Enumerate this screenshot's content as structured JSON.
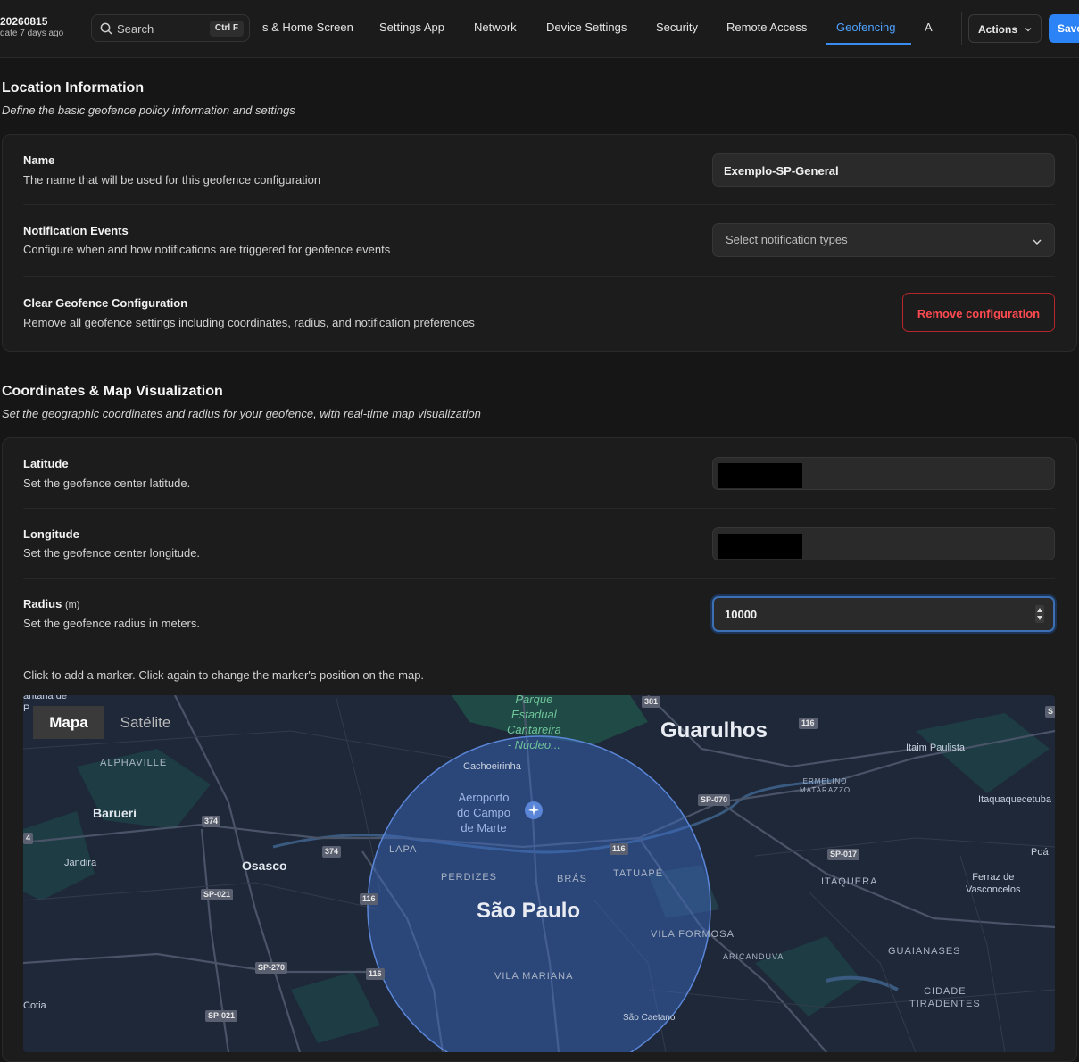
{
  "header": {
    "version_id": "20260815",
    "version_note": "date 7 days ago",
    "search_placeholder": "Search",
    "search_shortcut": "Ctrl F",
    "tabs": [
      {
        "label": "s & Home Screen",
        "active": false
      },
      {
        "label": "Settings App",
        "active": false
      },
      {
        "label": "Network",
        "active": false
      },
      {
        "label": "Device Settings",
        "active": false
      },
      {
        "label": "Security",
        "active": false
      },
      {
        "label": "Remote Access",
        "active": false
      },
      {
        "label": "Geofencing",
        "active": true
      },
      {
        "label": "A",
        "active": false
      }
    ],
    "actions_label": "Actions",
    "save_label": "Save"
  },
  "location_section": {
    "title": "Location Information",
    "subtitle": "Define the basic geofence policy information and settings",
    "name": {
      "title": "Name",
      "description": "The name that will be used for this geofence configuration",
      "value": "Exemplo-SP-General"
    },
    "notification": {
      "title": "Notification Events",
      "description": "Configure when and how notifications are triggered for geofence events",
      "placeholder": "Select notification types"
    },
    "clear": {
      "title": "Clear Geofence Configuration",
      "description": "Remove all geofence settings including coordinates, radius, and notification preferences",
      "button_label": "Remove configuration"
    }
  },
  "coordinates_section": {
    "title": "Coordinates & Map Visualization",
    "subtitle": "Set the geographic coordinates and radius for your geofence, with real-time map visualization",
    "latitude": {
      "title": "Latitude",
      "description": "Set the geofence center latitude."
    },
    "longitude": {
      "title": "Longitude",
      "description": "Set the geofence center longitude."
    },
    "radius": {
      "title": "Radius",
      "unit": "(m)",
      "description": "Set the geofence radius in meters.",
      "value": "10000"
    },
    "map_hint": "Click to add a marker. Click again to change the marker's position on the map."
  },
  "map": {
    "type_options": [
      "Mapa",
      "Satélite"
    ],
    "selected_type": "Mapa",
    "labels": {
      "guarulhos": "Guarulhos",
      "sao_paulo": "São Paulo",
      "barueri": "Barueri",
      "osasco": "Osasco",
      "jandira": "Jandira",
      "alphaville": "ALPHAVILLE",
      "cachoeirinha": "Cachoeirinha",
      "aeroporto": "Aeroporto\ndo Campo\nde Marte",
      "parque": "Parque\nEstadual\nCantareira\n- Núcleo...",
      "lapa": "LAPA",
      "perdizes": "PERDIZES",
      "bras": "BRÁS",
      "tatuape": "TATUAPÉ",
      "vila_formosa": "VILA FORMOSA",
      "aricanduva": "ARICANDUVA",
      "vila_mariana": "VILA MARIANA",
      "itaquera": "ITAQUERA",
      "guaianases": "GUAIANASES",
      "cidade_tiradentes": "CIDADE\nTIRADENTES",
      "ermelino": "ERMELINO\nMATARAZZO",
      "itaim": "Itaim Paulista",
      "itaquaquecetuba": "Itaquaquecetuba",
      "poa": "Poá",
      "ferraz": "Ferraz de\nVasconcelos",
      "cotia": "Cotia",
      "sao_caetano": "São Caetano",
      "santana": "antana de\nP"
    },
    "road_shields": [
      "381",
      "116",
      "SP-070",
      "116",
      "SP-017",
      "374",
      "374",
      "SP-021",
      "116",
      "SP-270",
      "116",
      "SP-021",
      "4",
      "S"
    ]
  }
}
